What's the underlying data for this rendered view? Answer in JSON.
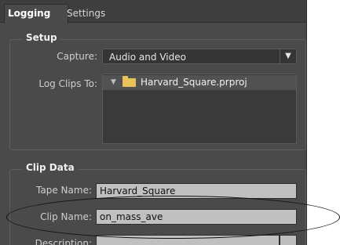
{
  "tabs": [
    {
      "label": "Logging"
    },
    {
      "label": "Settings"
    }
  ],
  "setup": {
    "title": "Setup",
    "capture_label": "Capture:",
    "capture_value": "Audio and Video",
    "log_clips_label": "Log Clips To:",
    "log_clips_item": "Harvard_Square.prproj"
  },
  "clip_data": {
    "title": "Clip Data",
    "tape_name_label": "Tape Name:",
    "tape_name_value": "Harvard_Square",
    "clip_name_label": "Clip Name:",
    "clip_name_value": "on_mass_ave",
    "description_label": "Description:"
  },
  "colors": {
    "panel_bg": "#4a4a4a",
    "field_bg": "#c0c0c0",
    "folder": "#e8c25a",
    "annotation_ellipse": "#111111"
  }
}
